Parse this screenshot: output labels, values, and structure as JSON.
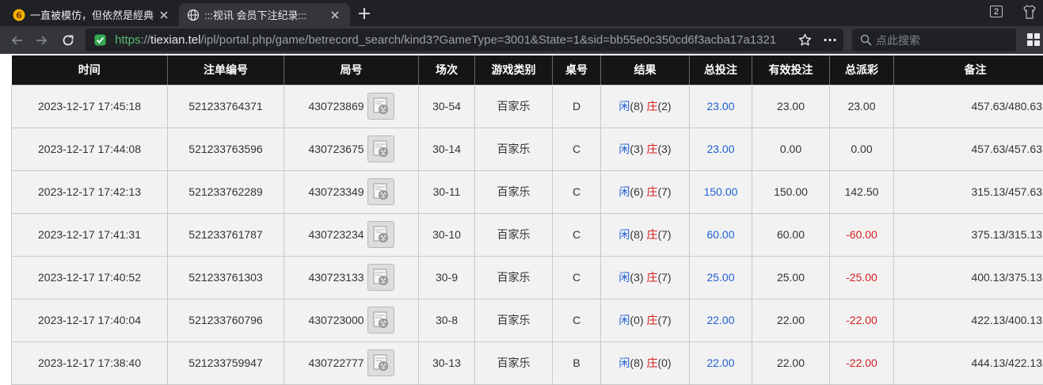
{
  "browser": {
    "tabs": [
      {
        "title": "一直被模仿，但依然是經典",
        "active": false
      },
      {
        "title": ":::视讯 会员下注纪录:::",
        "active": true
      }
    ],
    "tab_count": "2",
    "url_scheme": "https",
    "url_sep": "://",
    "url_host": "tiexian.tel",
    "url_path": "/ipl/portal.php/game/betrecord_search/kind3?GameType=3001&State=1&sid=bb55e0c350cd6f3acba17a1321",
    "search_placeholder": "点此搜索"
  },
  "colors": {
    "header_bg": "#151515",
    "cell_bg": "#f2f2f2",
    "link_blue": "#1f5fd6",
    "loss_red": "#d41f1f",
    "secure_green": "#5bb974"
  },
  "table": {
    "headers": [
      "时间",
      "注单编号",
      "局号",
      "场次",
      "游戏类别",
      "桌号",
      "结果",
      "总投注",
      "有效投注",
      "总派彩",
      "备注"
    ],
    "rows": [
      {
        "time": "2023-12-17 17:45:18",
        "order": "521233764371",
        "round": "430723869",
        "session": "30-54",
        "game": "百家乐",
        "table": "D",
        "xian_label": "闲",
        "xian": "(8)",
        "zhuang_label": "庄",
        "zhuang": "(2)",
        "bet": "23.00",
        "valid": "23.00",
        "payout": "23.00",
        "payout_negative": false,
        "note": "457.63/480.63"
      },
      {
        "time": "2023-12-17 17:44:08",
        "order": "521233763596",
        "round": "430723675",
        "session": "30-14",
        "game": "百家乐",
        "table": "C",
        "xian_label": "闲",
        "xian": "(3)",
        "zhuang_label": "庄",
        "zhuang": "(3)",
        "bet": "23.00",
        "valid": "0.00",
        "payout": "0.00",
        "payout_negative": false,
        "note": "457.63/457.63"
      },
      {
        "time": "2023-12-17 17:42:13",
        "order": "521233762289",
        "round": "430723349",
        "session": "30-11",
        "game": "百家乐",
        "table": "C",
        "xian_label": "闲",
        "xian": "(6)",
        "zhuang_label": "庄",
        "zhuang": "(7)",
        "bet": "150.00",
        "valid": "150.00",
        "payout": "142.50",
        "payout_negative": false,
        "note": "315.13/457.63"
      },
      {
        "time": "2023-12-17 17:41:31",
        "order": "521233761787",
        "round": "430723234",
        "session": "30-10",
        "game": "百家乐",
        "table": "C",
        "xian_label": "闲",
        "xian": "(8)",
        "zhuang_label": "庄",
        "zhuang": "(7)",
        "bet": "60.00",
        "valid": "60.00",
        "payout": "-60.00",
        "payout_negative": true,
        "note": "375.13/315.13"
      },
      {
        "time": "2023-12-17 17:40:52",
        "order": "521233761303",
        "round": "430723133",
        "session": "30-9",
        "game": "百家乐",
        "table": "C",
        "xian_label": "闲",
        "xian": "(3)",
        "zhuang_label": "庄",
        "zhuang": "(7)",
        "bet": "25.00",
        "valid": "25.00",
        "payout": "-25.00",
        "payout_negative": true,
        "note": "400.13/375.13"
      },
      {
        "time": "2023-12-17 17:40:04",
        "order": "521233760796",
        "round": "430723000",
        "session": "30-8",
        "game": "百家乐",
        "table": "C",
        "xian_label": "闲",
        "xian": "(0)",
        "zhuang_label": "庄",
        "zhuang": "(7)",
        "bet": "22.00",
        "valid": "22.00",
        "payout": "-22.00",
        "payout_negative": true,
        "note": "422.13/400.13"
      },
      {
        "time": "2023-12-17 17:38:40",
        "order": "521233759947",
        "round": "430722777",
        "session": "30-13",
        "game": "百家乐",
        "table": "B",
        "xian_label": "闲",
        "xian": "(8)",
        "zhuang_label": "庄",
        "zhuang": "(0)",
        "bet": "22.00",
        "valid": "22.00",
        "payout": "-22.00",
        "payout_negative": true,
        "note": "444.13/422.13"
      }
    ]
  }
}
